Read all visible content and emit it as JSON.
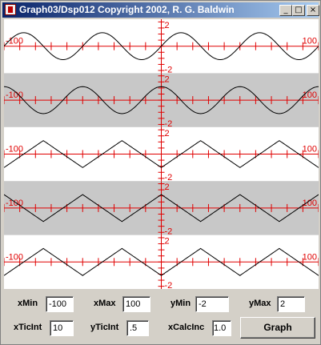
{
  "window": {
    "title": "Graph03/Dsp012 Copyright 2002, R. G. Baldwin",
    "minimize_glyph": "_",
    "maximize_glyph": "□",
    "close_glyph": "×"
  },
  "axis_labels": {
    "x_left": "-100",
    "x_right": "100",
    "y_top": "2",
    "y_bottom": "-2"
  },
  "chart_data": [
    {
      "type": "line",
      "series": [
        {
          "values_desc": "sine"
        }
      ],
      "xlim": [
        -100,
        100
      ],
      "ylim": [
        -2,
        2
      ],
      "shaded": false
    },
    {
      "type": "line",
      "series": [
        {
          "values_desc": "cosine"
        }
      ],
      "xlim": [
        -100,
        100
      ],
      "ylim": [
        -2,
        2
      ],
      "shaded": true
    },
    {
      "type": "line",
      "series": [
        {
          "values_desc": "triangle"
        }
      ],
      "xlim": [
        -100,
        100
      ],
      "ylim": [
        -2,
        2
      ],
      "shaded": false
    },
    {
      "type": "line",
      "series": [
        {
          "values_desc": "triangle-inverted"
        }
      ],
      "xlim": [
        -100,
        100
      ],
      "ylim": [
        -2,
        2
      ],
      "shaded": true
    },
    {
      "type": "line",
      "series": [
        {
          "values_desc": "triangle"
        }
      ],
      "xlim": [
        -100,
        100
      ],
      "ylim": [
        -2,
        2
      ],
      "shaded": false
    }
  ],
  "colors": {
    "axis": "#e00000",
    "shade": "#c8c8c8",
    "curve": "#000000"
  },
  "controls": {
    "xMin_label": "xMin",
    "xMin_value": "-100",
    "xMax_label": "xMax",
    "xMax_value": "100",
    "yMin_label": "yMin",
    "yMin_value": "-2",
    "yMax_label": "yMax",
    "yMax_value": "2",
    "xTicInt_label": "xTicInt",
    "xTicInt_value": "10",
    "yTicInt_label": "yTicInt",
    "yTicInt_value": ".5",
    "xCalcInc_label": "xCalcInc",
    "xCalcInc_value": "1.0",
    "graph_button": "Graph"
  }
}
